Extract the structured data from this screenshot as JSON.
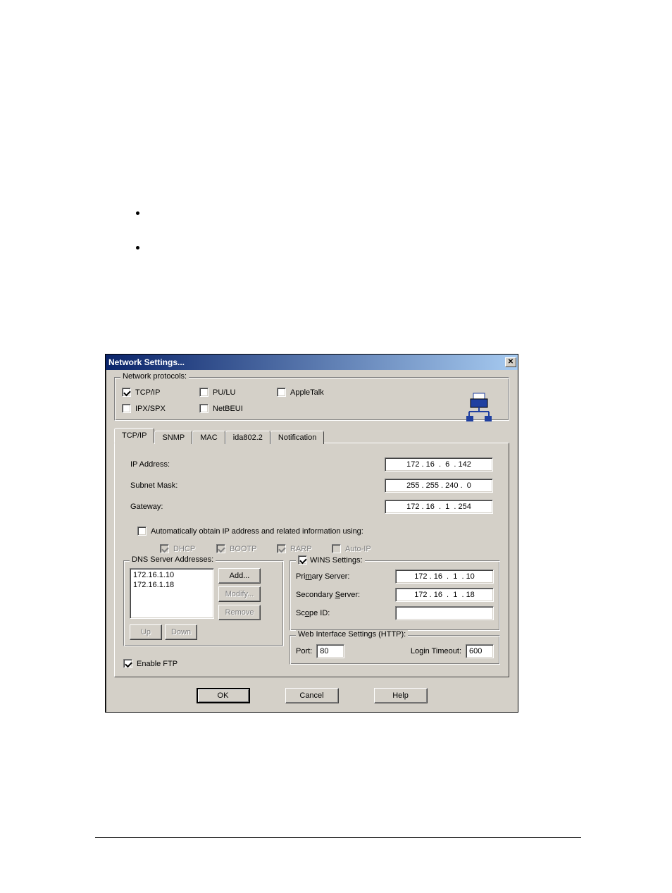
{
  "dialog": {
    "title": "Network Settings...",
    "protocols": {
      "group_label": "Network protocols:",
      "tcpip": "TCP/IP",
      "pulu": "PU/LU",
      "appletalk": "AppleTalk",
      "ipxspx": "IPX/SPX",
      "netbeui": "NetBEUI"
    },
    "tabs": [
      "TCP/IP",
      "SNMP",
      "MAC",
      "ida802.2",
      "Notification"
    ],
    "tcpip": {
      "ip_label": "IP Address:",
      "ip_value": "172 . 16  .  6  . 142",
      "subnet_label": "Subnet Mask:",
      "subnet_value": "255 . 255 . 240 .  0",
      "gateway_label": "Gateway:",
      "gateway_value": "172 . 16  .  1  . 254",
      "auto_obtain": "Automatically obtain IP address and related information using:",
      "dhcp": "DHCP",
      "bootp": "BOOTP",
      "rarp": "RARP",
      "autoip": "Auto-IP",
      "dns": {
        "group_label": "DNS Server Addresses:",
        "list": [
          "172.16.1.10",
          "172.16.1.18"
        ],
        "add": "Add...",
        "modify": "Modify...",
        "remove": "Remove",
        "up": "Up",
        "down": "Down"
      },
      "wins": {
        "group_label": "WINS Settings:",
        "primary_label": "Primary Server:",
        "primary_value": "172 . 16  .  1  . 10",
        "secondary_label": "Secondary Server:",
        "secondary_value": "172 . 16  .  1  . 18",
        "scope_label": "Scope ID:",
        "scope_value": ""
      },
      "http": {
        "group_label": "Web Interface Settings (HTTP):",
        "port_label": "Port:",
        "port_value": "80",
        "timeout_label": "Login Timeout:",
        "timeout_value": "600"
      },
      "enable_ftp": "Enable FTP"
    },
    "buttons": {
      "ok": "OK",
      "cancel": "Cancel",
      "help": "Help"
    }
  }
}
